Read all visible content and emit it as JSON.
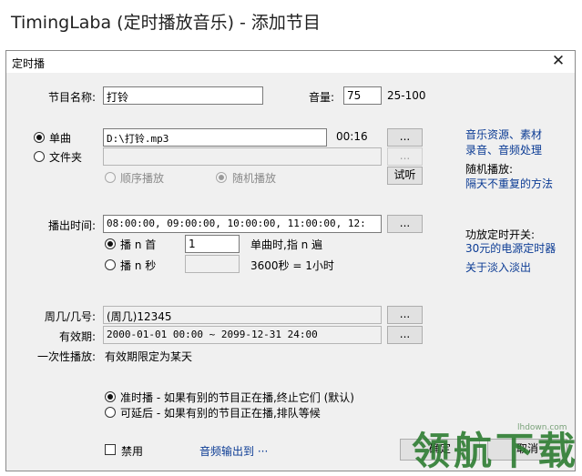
{
  "window_title": "TimingLaba (定时播放音乐) - 添加节目",
  "dialog": {
    "title": "定时播",
    "close_icon": "close-icon"
  },
  "program_name": {
    "label": "节目名称:",
    "value": "打铃"
  },
  "volume": {
    "label": "音量:",
    "value": "75",
    "range": "25-100"
  },
  "source": {
    "single_label": "单曲",
    "single_selected": true,
    "single_path": "D:\\打铃.mp3",
    "duration": "00:16",
    "browse_label": "...",
    "folder_label": "文件夹",
    "folder_selected": false,
    "folder_path": "",
    "sequential_label": "顺序播放",
    "random_label": "随机播放",
    "listen_label": "试听"
  },
  "side_links": {
    "music_resources": "音乐资源、素材",
    "recording": "录音、音频处理",
    "random_play_title": "随机播放:",
    "random_play_link": "隔天不重复的方法",
    "amp_title": "功放定时开关:",
    "amp_link": "30元的电源定时器",
    "fade_link": "关于淡入淡出"
  },
  "play_time": {
    "label": "播出时间:",
    "value": "08:00:00, 09:00:00, 10:00:00, 11:00:00, 12:",
    "browse_label": "...",
    "mode_first_label": "播 n 首",
    "mode_first_selected": true,
    "n_value": "1",
    "n_hint": "单曲时,指 n 遍",
    "mode_seconds_label": "播 n 秒",
    "mode_seconds_selected": false,
    "seconds_value": "",
    "seconds_hint": "3600秒 = 1小时"
  },
  "weekday": {
    "label": "周几/几号:",
    "value": "(周几)12345",
    "browse_label": "..."
  },
  "validity": {
    "label": "有效期:",
    "value": "2000-01-01 00:00 ~ 2099-12-31 24:00",
    "browse_label": "..."
  },
  "one_time": {
    "label": "一次性播放:",
    "value": "有效期限定为某天"
  },
  "conflict": {
    "on_time_label": "准时播 - 如果有别的节目正在播,终止它们 (默认)",
    "on_time_selected": true,
    "delay_label": "可延后 - 如果有别的节目正在播,排队等候",
    "delay_selected": false
  },
  "footer": {
    "disable_label": "禁用",
    "disable_checked": false,
    "audio_output_label": "音频输出到 ···",
    "ok_label": "确定",
    "cancel_label": "取消"
  },
  "watermark": {
    "text": "领航下载",
    "site": "lhdown.com"
  }
}
